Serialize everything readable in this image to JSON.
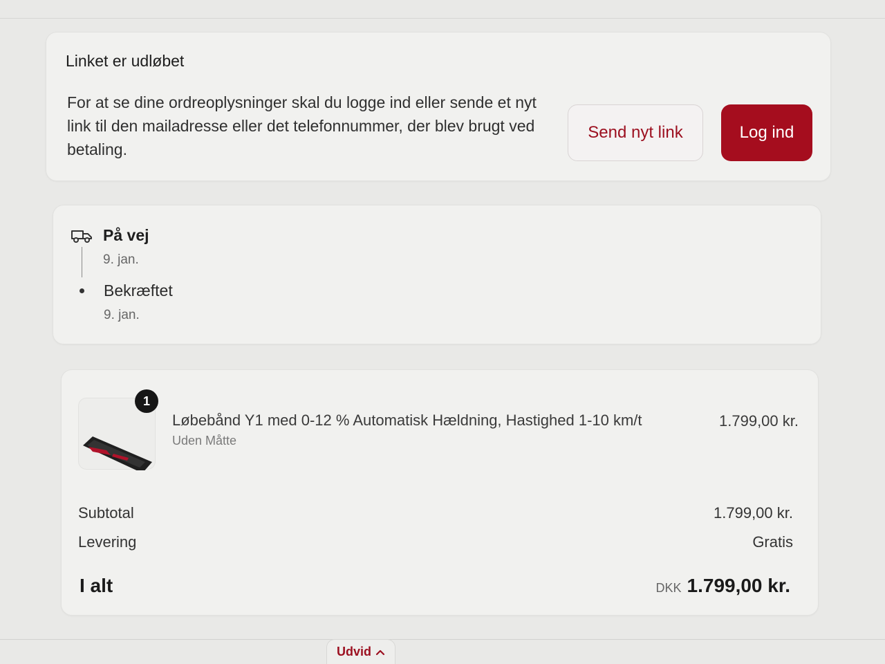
{
  "expired": {
    "title": "Linket er udløbet",
    "body": "For at se dine ordreoplysninger skal du logge ind eller sende et nyt link til den mailadresse eller det telefonnummer, der blev brugt ved betaling.",
    "send_link_label": "Send nyt link",
    "login_label": "Log ind",
    "accent": "#a50d1e"
  },
  "status": {
    "steps": [
      {
        "label": "På vej",
        "date": "9. jan.",
        "icon": "truck-icon"
      },
      {
        "label": "Bekræftet",
        "date": "9. jan.",
        "icon": "dot-icon"
      }
    ]
  },
  "order": {
    "item": {
      "quantity": "1",
      "name": "Løbebånd Y1 med 0-12 % Automatisk Hældning, Hastighed 1-10 km/t",
      "variant": "Uden Måtte",
      "price": "1.799,00 kr."
    },
    "subtotal_label": "Subtotal",
    "subtotal_value": "1.799,00 kr.",
    "shipping_label": "Levering",
    "shipping_value": "Gratis",
    "total_label": "I alt",
    "total_currency": "DKK",
    "total_value": "1.799,00 kr."
  },
  "footer": {
    "expand_label": "Udvid",
    "expand_icon": "chevron-up-icon"
  }
}
